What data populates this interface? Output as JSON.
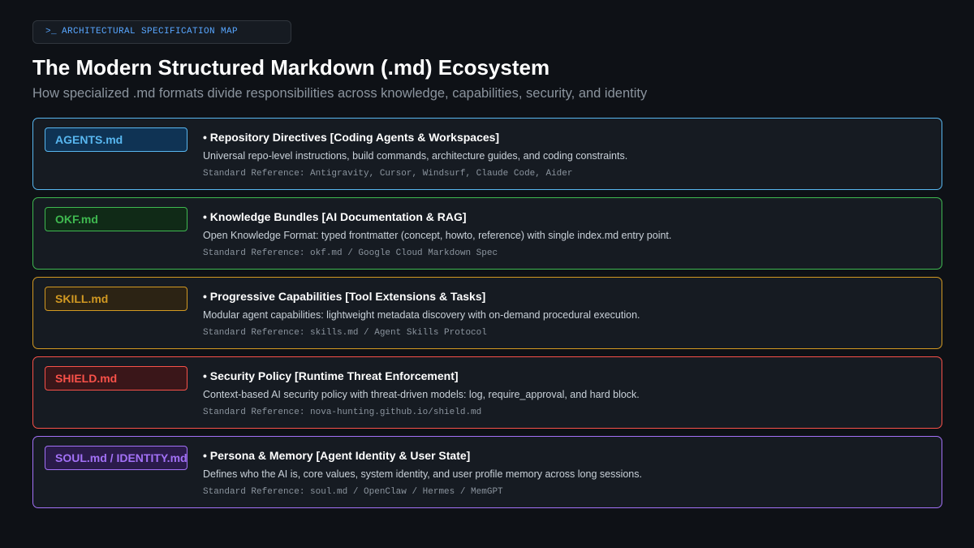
{
  "header": {
    "tag_prompt": ">_",
    "tag_label": "ARCHITECTURAL SPECIFICATION MAP",
    "title": "The Modern Structured Markdown (.md) Ecosystem",
    "subtitle": "How specialized .md formats divide responsibilities across knowledge, capabilities, security, and identity"
  },
  "cards": [
    {
      "pill": "AGENTS.md",
      "heading": "• Repository Directives [Coding Agents & Workspaces]",
      "description": "Universal repo-level instructions, build commands, architecture guides, and coding constraints.",
      "reference": "Standard Reference: Antigravity, Cursor, Windsurf, Claude Code, Aider",
      "accent": "#58b7f0",
      "pill_bg": "#0f3354"
    },
    {
      "pill": "OKF.md",
      "heading": "• Knowledge Bundles [AI Documentation & RAG]",
      "description": "Open Knowledge Format: typed frontmatter (concept, howto, reference) with single index.md entry point.",
      "reference": "Standard Reference: okf.md / Google Cloud Markdown Spec",
      "accent": "#3fb950",
      "pill_bg": "#102a17"
    },
    {
      "pill": "SKILL.md",
      "heading": "• Progressive Capabilities [Tool Extensions & Tasks]",
      "description": "Modular agent capabilities: lightweight metadata discovery with on-demand procedural execution.",
      "reference": "Standard Reference: skills.md / Agent Skills Protocol",
      "accent": "#d29922",
      "pill_bg": "#2c2314"
    },
    {
      "pill": "SHIELD.md",
      "heading": "• Security Policy [Runtime Threat Enforcement]",
      "description": "Context-based AI security policy with threat-driven models: log, require_approval, and hard block.",
      "reference": "Standard Reference: nova-hunting.github.io/shield.md",
      "accent": "#f85149",
      "pill_bg": "#3a1619"
    },
    {
      "pill": "SOUL.md / IDENTITY.md",
      "heading": "• Persona & Memory [Agent Identity & User State]",
      "description": "Defines who the AI is, core values, system identity, and user profile memory across long sessions.",
      "reference": "Standard Reference: soul.md / OpenClaw / Hermes / MemGPT",
      "accent": "#a371f7",
      "pill_bg": "#2a1b4a"
    }
  ]
}
